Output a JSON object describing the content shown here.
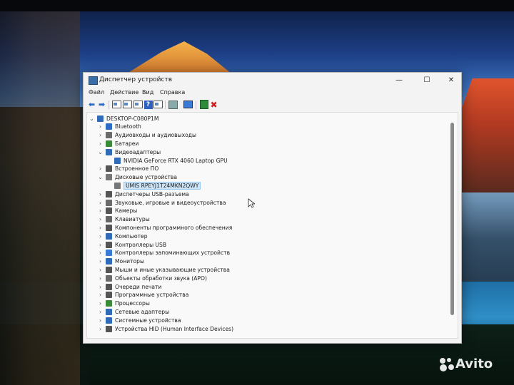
{
  "window": {
    "title": "Диспетчер устройств",
    "minimize_glyph": "—",
    "maximize_glyph": "☐",
    "close_glyph": "✕"
  },
  "menu": [
    "Файл",
    "Действие",
    "Вид",
    "Справка"
  ],
  "toolbar": {
    "back_glyph": "⬅",
    "forward_glyph": "➡",
    "help_glyph": "?",
    "remove_glyph": "✖"
  },
  "tree": {
    "root": "DESKTOP-C080P1M",
    "items": [
      {
        "label": "Bluetooth",
        "icon": "bluetooth-icon",
        "color": "#2d6bc4"
      },
      {
        "label": "Аудиовходы и аудиовыходы",
        "icon": "speaker-icon",
        "color": "#6b6b6b"
      },
      {
        "label": "Батареи",
        "icon": "battery-icon",
        "color": "#3a8a3a"
      },
      {
        "label": "Видеоадаптеры",
        "icon": "display-adapter-icon",
        "color": "#2f6bb8"
      },
      {
        "label": "NVIDIA GeForce RTX 4060 Laptop GPU",
        "icon": "display-adapter-icon",
        "color": "#2f6bb8"
      },
      {
        "label": "Встроенное ПО",
        "icon": "firmware-icon",
        "color": "#555555"
      },
      {
        "label": "Дисковые устройства",
        "icon": "disk-icon",
        "color": "#777777"
      },
      {
        "label": "UMIS RPEYJ1T24MKN2QWY",
        "icon": "disk-icon",
        "color": "#777777"
      },
      {
        "label": "Диспетчеры USB-разъема",
        "icon": "usb-icon",
        "color": "#555555"
      },
      {
        "label": "Звуковые, игровые и видеоустройства",
        "icon": "sound-icon",
        "color": "#6b6b6b"
      },
      {
        "label": "Камеры",
        "icon": "camera-icon",
        "color": "#555555"
      },
      {
        "label": "Клавиатуры",
        "icon": "keyboard-icon",
        "color": "#666666"
      },
      {
        "label": "Компоненты программного обеспечения",
        "icon": "software-component-icon",
        "color": "#555555"
      },
      {
        "label": "Компьютер",
        "icon": "computer-icon",
        "color": "#2f6bb8"
      },
      {
        "label": "Контроллеры USB",
        "icon": "usb-controller-icon",
        "color": "#555555"
      },
      {
        "label": "Контроллеры запоминающих устройств",
        "icon": "storage-controller-icon",
        "color": "#3a7bd5"
      },
      {
        "label": "Мониторы",
        "icon": "monitor-icon",
        "color": "#2f6bb8"
      },
      {
        "label": "Мыши и иные указывающие устройства",
        "icon": "mouse-icon",
        "color": "#555555"
      },
      {
        "label": "Объекты обработки звука (APO)",
        "icon": "audio-processing-icon",
        "color": "#6b6b6b"
      },
      {
        "label": "Очереди печати",
        "icon": "printer-icon",
        "color": "#555555"
      },
      {
        "label": "Программные устройства",
        "icon": "software-device-icon",
        "color": "#555555"
      },
      {
        "label": "Процессоры",
        "icon": "processor-icon",
        "color": "#3a8a3a"
      },
      {
        "label": "Сетевые адаптеры",
        "icon": "network-adapter-icon",
        "color": "#2f6bb8"
      },
      {
        "label": "Системные устройства",
        "icon": "system-device-icon",
        "color": "#2f6bb8"
      },
      {
        "label": "Устройства HID (Human Interface Devices)",
        "icon": "hid-icon",
        "color": "#555555"
      }
    ]
  },
  "watermark": "Avito"
}
